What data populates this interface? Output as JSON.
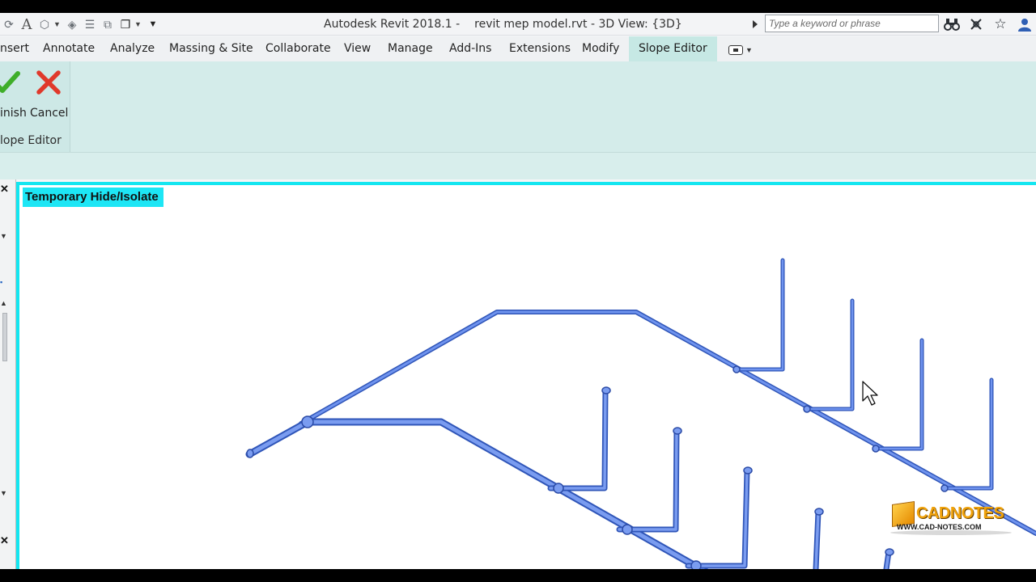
{
  "window": {
    "app_title": "Autodesk Revit 2018.1 -",
    "document_title": "revit mep model.rvt - 3D View: {3D}"
  },
  "search": {
    "placeholder": "Type a keyword or phrase"
  },
  "title_icons": [
    "binoculars-icon",
    "exchange-icon",
    "star-icon",
    "user-icon"
  ],
  "quick_access_icons": [
    "sync-icon",
    "text-icon",
    "3d-box-icon",
    "tag-icon",
    "thin-lines-icon",
    "close-views-icon",
    "switch-windows-icon",
    "customize-icon"
  ],
  "ribbon": {
    "tabs": [
      {
        "label": "Insert",
        "display": "nsert"
      },
      {
        "label": "Annotate"
      },
      {
        "label": "Analyze"
      },
      {
        "label": "Massing & Site"
      },
      {
        "label": "Collaborate"
      },
      {
        "label": "View"
      },
      {
        "label": "Manage"
      },
      {
        "label": "Add-Ins"
      },
      {
        "label": "Extensions"
      },
      {
        "label": "Modify"
      },
      {
        "label": "Slope Editor",
        "active": true
      }
    ],
    "panel": {
      "title_display": "lope Editor",
      "finish_label_display": "inish",
      "cancel_label": "Cancel"
    }
  },
  "view": {
    "mode_label": "Temporary Hide/Isolate",
    "border_color": "#14e6f0",
    "pipe_color": "#4a74d8"
  },
  "watermark": {
    "brand": "CADNOTES",
    "url": "WWW.CAD-NOTES.COM"
  },
  "colors": {
    "ribbon_active": "#c6e8e4",
    "ribbon_panel": "#d4ecea",
    "finish_icon": "#3fae2a",
    "cancel_icon": "#e0392b"
  }
}
